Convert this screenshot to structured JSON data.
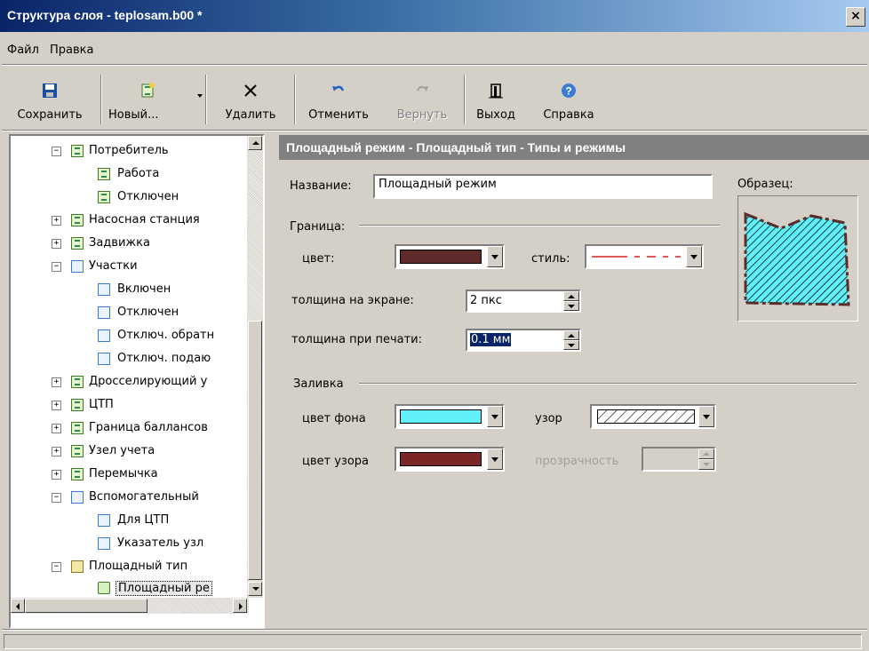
{
  "window": {
    "title": "Структура слоя - teplosam.b00 *",
    "close_glyph": "×"
  },
  "menu": [
    {
      "label": "Файл"
    },
    {
      "label": "Правка"
    }
  ],
  "toolbar": {
    "save": "Сохранить",
    "new": "Новый...",
    "delete": "Удалить",
    "undo": "Отменить",
    "redo": "Вернуть",
    "exit": "Выход",
    "help": "Справка"
  },
  "tree": {
    "nodes": [
      {
        "label": "Потребитель",
        "expander": "−",
        "icon": "green"
      },
      {
        "label": "Работа",
        "icon": "green"
      },
      {
        "label": "Отключен",
        "icon": "green"
      },
      {
        "label": "Насосная станция",
        "expander": "+",
        "icon": "green"
      },
      {
        "label": "Задвижка",
        "expander": "+",
        "icon": "green"
      },
      {
        "label": "Участки",
        "expander": "−",
        "icon": "line"
      },
      {
        "label": "Включен",
        "icon": "line"
      },
      {
        "label": "Отключен",
        "icon": "line"
      },
      {
        "label": "Отключ. обратн",
        "icon": "line"
      },
      {
        "label": "Отключ. подаю",
        "icon": "line"
      },
      {
        "label": "Дросселирующий у",
        "expander": "+",
        "icon": "green"
      },
      {
        "label": "ЦТП",
        "expander": "+",
        "icon": "green"
      },
      {
        "label": "Граница баллансов",
        "expander": "+",
        "icon": "green"
      },
      {
        "label": "Узел учета",
        "expander": "+",
        "icon": "green"
      },
      {
        "label": "Перемычка",
        "expander": "+",
        "icon": "green"
      },
      {
        "label": "Вспомогательный",
        "expander": "−",
        "icon": "line"
      },
      {
        "label": "Для ЦТП",
        "icon": "line"
      },
      {
        "label": "Указатель узл",
        "icon": "line"
      },
      {
        "label": "Площадный тип",
        "expander": "−",
        "icon": "folder"
      },
      {
        "label": "Площадный ре",
        "icon": "leaf",
        "selected": true
      }
    ]
  },
  "panel": {
    "header": "Площадный режим - Площадный тип - Типы и режимы",
    "name_label": "Название:",
    "name_value": "Площадный режим",
    "sample_label": "Образец:",
    "border_group": "Граница:",
    "color_label": "цвет:",
    "style_label": "стиль:",
    "thickness_screen_label": "толщина на экране:",
    "thickness_screen_value": "2 пкс",
    "thickness_print_label": "толщина при печати:",
    "thickness_print_value": "0.1 мм",
    "fill_group": "Заливка",
    "bg_color_label": "цвет фона",
    "pattern_label": "узор",
    "pattern_color_label": "цвет узора",
    "transparency_label": "прозрачность",
    "colors": {
      "border": "#5e2a2a",
      "background": "#5ff0f8",
      "pattern": "#7a2626",
      "style_line": "#d02020"
    }
  }
}
